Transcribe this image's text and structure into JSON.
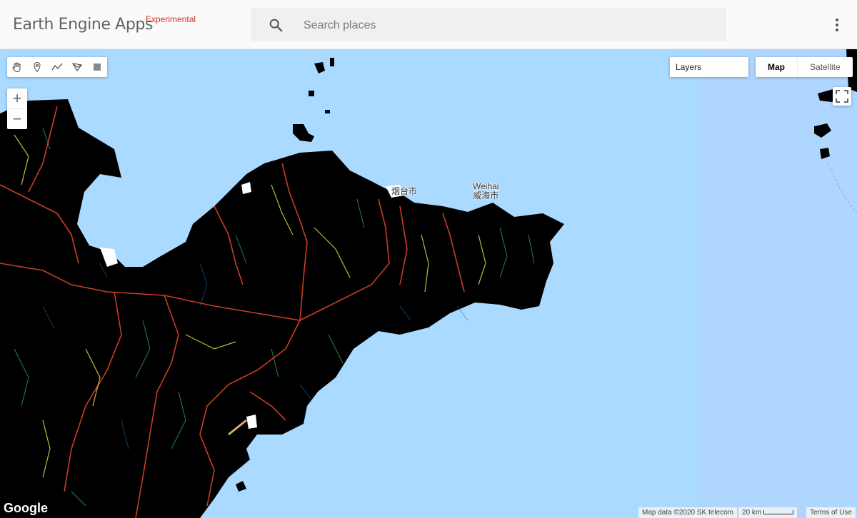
{
  "header": {
    "app_title": "Earth Engine Apps",
    "app_badge": "Experimental",
    "search": {
      "placeholder": "Search places",
      "value": ""
    },
    "more_icon": "more-vert-icon"
  },
  "map": {
    "draw_tools": [
      {
        "name": "pan-hand-icon"
      },
      {
        "name": "point-marker-icon"
      },
      {
        "name": "polyline-icon"
      },
      {
        "name": "polygon-icon"
      },
      {
        "name": "rectangle-icon"
      }
    ],
    "zoom": {
      "in_label": "+",
      "out_label": "−"
    },
    "layers_label": "Layers",
    "map_type": {
      "map_label": "Map",
      "satellite_label": "Satellite",
      "selected": "Map"
    },
    "places": [
      {
        "name": "Weihai",
        "local": "威海市"
      },
      {
        "name": "",
        "local": "烟台市"
      }
    ],
    "attribution": "Map data ©2020 SK telecom",
    "scale_label": "20 km",
    "terms_label": "Terms of Use",
    "google_logo": "Google",
    "colors": {
      "water": "#aadaff",
      "land": "#000000",
      "stream_high": "#e0442a",
      "stream_mid": "#e8d94a",
      "stream_low": "#2fa84f"
    }
  }
}
